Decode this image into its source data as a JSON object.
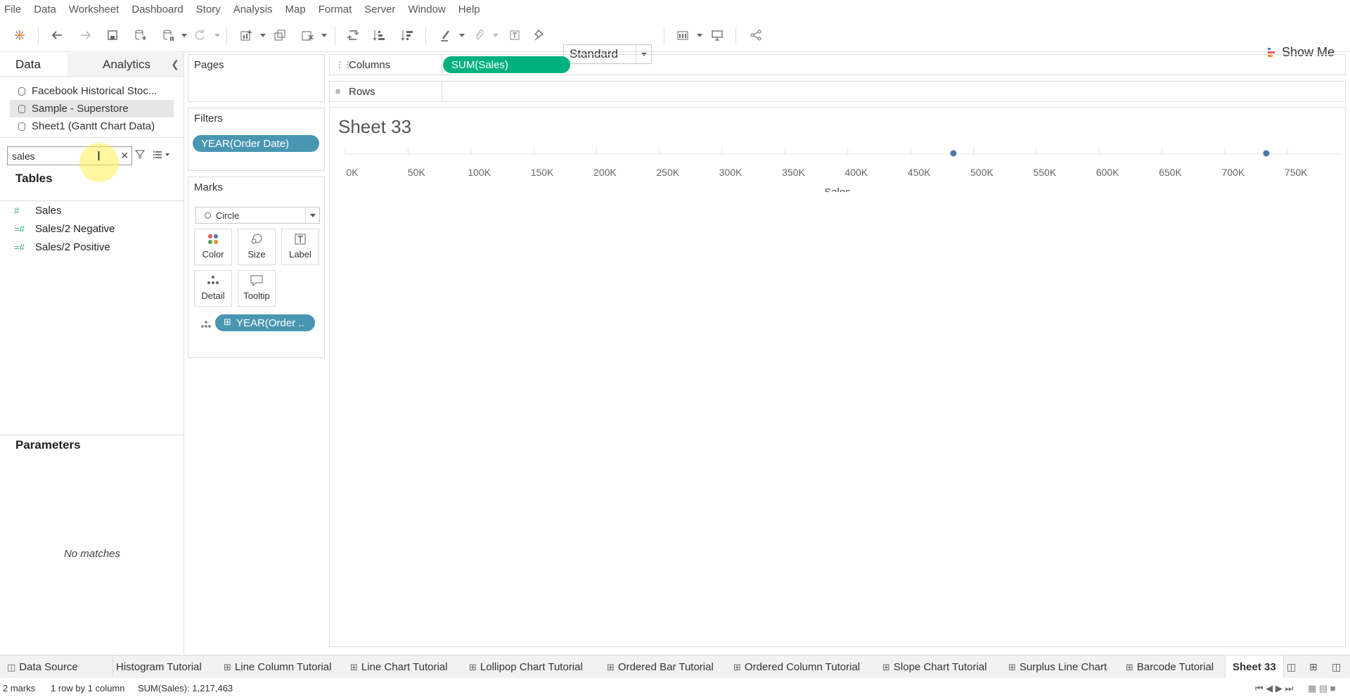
{
  "menu": [
    "File",
    "Data",
    "Worksheet",
    "Dashboard",
    "Story",
    "Analysis",
    "Map",
    "Format",
    "Server",
    "Window",
    "Help"
  ],
  "toolbar": {
    "fit_mode": "Standard",
    "show_me": "Show Me"
  },
  "data_pane": {
    "tab_data": "Data",
    "tab_analytics": "Analytics",
    "sources": [
      "Facebook Historical Stoc...",
      "Sample - Superstore",
      "Sheet1 (Gantt Chart Data)"
    ],
    "search_value": "sales",
    "tables_header": "Tables",
    "fields": [
      "Sales",
      "Sales/2 Negative",
      "Sales/2 Positive"
    ],
    "parameters_header": "Parameters",
    "no_matches": "No matches"
  },
  "cards": {
    "pages": "Pages",
    "filters": "Filters",
    "filter_pill": "YEAR(Order Date)",
    "marks": "Marks",
    "mark_type": "Circle",
    "mark_buttons": [
      "Color",
      "Size",
      "Label",
      "Detail",
      "Tooltip"
    ],
    "detail_pill": "YEAR(Order .."
  },
  "shelves": {
    "columns": "Columns",
    "columns_pill": "SUM(Sales)",
    "rows": "Rows"
  },
  "sheet": {
    "title": "Sheet 33"
  },
  "chart_data": {
    "type": "scatter",
    "title": "Sheet 33",
    "xlabel": "Sales",
    "ylabel": "",
    "xlim": [
      0,
      770000
    ],
    "x_ticks": [
      "0K",
      "50K",
      "100K",
      "150K",
      "200K",
      "250K",
      "300K",
      "350K",
      "400K",
      "450K",
      "500K",
      "550K",
      "600K",
      "650K",
      "700K",
      "750K"
    ],
    "x_tick_values": [
      0,
      50000,
      100000,
      150000,
      200000,
      250000,
      300000,
      350000,
      400000,
      450000,
      500000,
      550000,
      600000,
      650000,
      700000,
      750000
    ],
    "points": [
      484000,
      733000
    ],
    "color": "#4e79a7"
  },
  "bottom_tabs": [
    "Data Source",
    "Histogram Tutorial",
    "Line Column Tutorial",
    "Line Chart Tutorial",
    "Lollipop Chart Tutorial",
    "Ordered Bar Tutorial",
    "Ordered Column Tutorial",
    "Slope Chart Tutorial",
    "Surplus Line Chart",
    "Barcode Tutorial",
    "Sheet 33"
  ],
  "status": {
    "marks": "2 marks",
    "rows_cols": "1 row by 1 column",
    "sum": "SUM(Sales): 1,217,463"
  }
}
